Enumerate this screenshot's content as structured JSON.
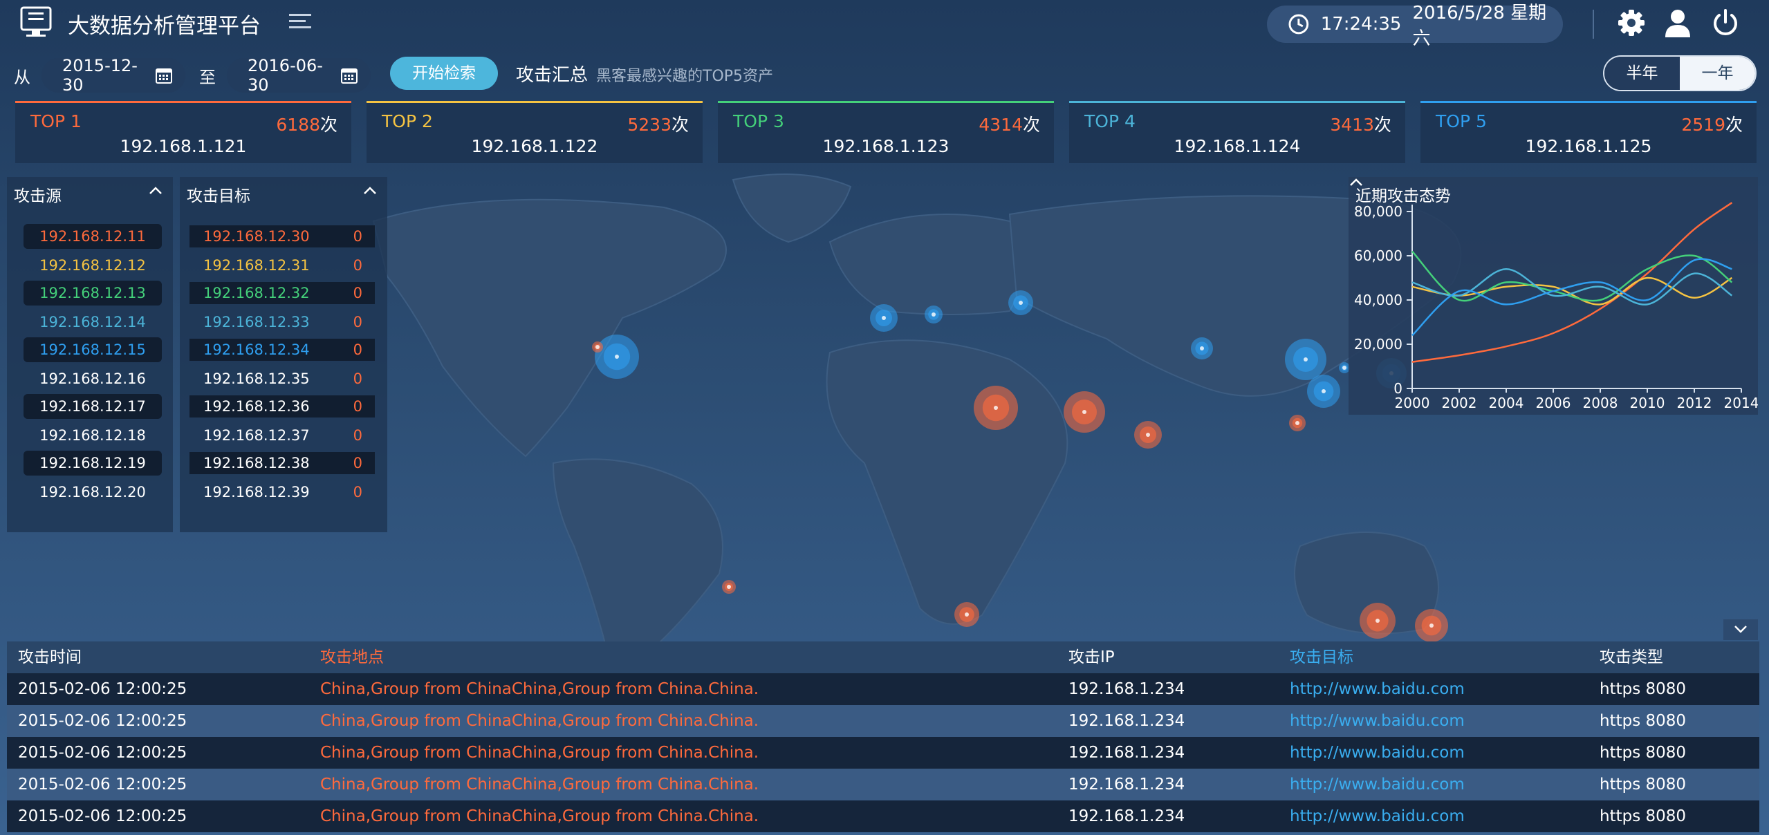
{
  "header": {
    "title": "大数据分析管理平台",
    "time": "17:24:35",
    "date": "2016/5/28 星期六",
    "icons": [
      "monitor-icon",
      "menu-icon",
      "clock-icon",
      "gear-icon",
      "user-icon",
      "power-icon"
    ]
  },
  "filter": {
    "from_label": "从",
    "from_value": "2015-12-30",
    "to_label": "至",
    "to_value": "2016-06-30",
    "search_label": "开始检索",
    "summary_title": "攻击汇总",
    "summary_sub": "黑客最感兴趣的TOP5资产",
    "range_options": [
      "半年",
      "一年"
    ],
    "range_selected": "半年"
  },
  "top_cards": [
    {
      "rank": "TOP 1",
      "count": "6188",
      "unit": "次",
      "ip": "192.168.1.121",
      "color": "#ff6a3c"
    },
    {
      "rank": "TOP 2",
      "count": "5233",
      "unit": "次",
      "ip": "192.168.1.122",
      "color": "#f5c342"
    },
    {
      "rank": "TOP 3",
      "count": "4314",
      "unit": "次",
      "ip": "192.168.1.123",
      "color": "#44d07a"
    },
    {
      "rank": "TOP 4",
      "count": "3413",
      "unit": "次",
      "ip": "192.168.1.124",
      "color": "#4cb4d8"
    },
    {
      "rank": "TOP 5",
      "count": "2519",
      "unit": "次",
      "ip": "192.168.1.125",
      "color": "#2f9ff0"
    }
  ],
  "sources": {
    "title": "攻击源",
    "items": [
      {
        "ip": "192.168.12.11",
        "color": "#ff6a3c"
      },
      {
        "ip": "192.168.12.12",
        "color": "#f5c342"
      },
      {
        "ip": "192.168.12.13",
        "color": "#44d07a"
      },
      {
        "ip": "192.168.12.14",
        "color": "#4cb4d8"
      },
      {
        "ip": "192.168.12.15",
        "color": "#2f9ff0"
      },
      {
        "ip": "192.168.12.16",
        "color": "#ffffff"
      },
      {
        "ip": "192.168.12.17",
        "color": "#ffffff"
      },
      {
        "ip": "192.168.12.18",
        "color": "#ffffff"
      },
      {
        "ip": "192.168.12.19",
        "color": "#ffffff"
      },
      {
        "ip": "192.168.12.20",
        "color": "#ffffff"
      }
    ]
  },
  "targets": {
    "title": "攻击目标",
    "items": [
      {
        "ip": "192.168.12.30",
        "value": "0",
        "color": "#ff6a3c"
      },
      {
        "ip": "192.168.12.31",
        "value": "0",
        "color": "#f5c342"
      },
      {
        "ip": "192.168.12.32",
        "value": "0",
        "color": "#44d07a"
      },
      {
        "ip": "192.168.12.33",
        "value": "0",
        "color": "#4cb4d8"
      },
      {
        "ip": "192.168.12.34",
        "value": "0",
        "color": "#2f9ff0"
      },
      {
        "ip": "192.168.12.35",
        "value": "0",
        "color": "#ffffff"
      },
      {
        "ip": "192.168.12.36",
        "value": "0",
        "color": "#ffffff"
      },
      {
        "ip": "192.168.12.37",
        "value": "0",
        "color": "#ffffff"
      },
      {
        "ip": "192.168.12.38",
        "value": "0",
        "color": "#ffffff"
      },
      {
        "ip": "192.168.12.39",
        "value": "0",
        "color": "#ffffff"
      }
    ]
  },
  "trend": {
    "title": "近期攻击态势",
    "chart_data": {
      "type": "line",
      "xlim": [
        2000,
        2014
      ],
      "ylim": [
        0,
        80000
      ],
      "xticks": [
        "2000",
        "2002",
        "2004",
        "2006",
        "2008",
        "2010",
        "2012",
        "2014"
      ],
      "yticks": [
        "0",
        "20,000",
        "40,000",
        "60,000",
        "80,000"
      ],
      "grid": false,
      "series": [
        {
          "color": "#ff6a3c",
          "x": [
            2000,
            2002,
            2004,
            2006,
            2008,
            2010,
            2012,
            2013.6
          ],
          "y": [
            12000,
            15000,
            19000,
            25000,
            36000,
            52000,
            72000,
            84000
          ]
        },
        {
          "color": "#f5c342",
          "x": [
            2000,
            2002,
            2004,
            2006,
            2008,
            2010,
            2012,
            2013.6
          ],
          "y": [
            46000,
            42000,
            46000,
            46000,
            38000,
            50000,
            41000,
            50000
          ]
        },
        {
          "color": "#44d07a",
          "x": [
            2000,
            2002,
            2004,
            2006,
            2008,
            2010,
            2012,
            2013.6
          ],
          "y": [
            62000,
            40000,
            48000,
            44000,
            40000,
            54000,
            60000,
            48000
          ]
        },
        {
          "color": "#4cb4d8",
          "x": [
            2000,
            2002,
            2004,
            2006,
            2008,
            2010,
            2012,
            2013.6
          ],
          "y": [
            48000,
            42000,
            54000,
            42000,
            46000,
            38000,
            52000,
            42000
          ]
        },
        {
          "color": "#2f9ff0",
          "x": [
            2000,
            2002,
            2004,
            2006,
            2008,
            2010,
            2012,
            2013.6
          ],
          "y": [
            24000,
            44000,
            38000,
            44000,
            48000,
            40000,
            58000,
            54000
          ]
        }
      ]
    }
  },
  "map": {
    "red_color": "#ff6a3c",
    "blue_color": "#2f9ff0"
  },
  "table": {
    "headers": [
      "攻击时间",
      "攻击地点",
      "攻击IP",
      "攻击目标",
      "攻击类型"
    ],
    "header_colors": [
      "#ffffff",
      "#ff6a3c",
      "#ffffff",
      "#3aaef0",
      "#ffffff"
    ],
    "rows": [
      {
        "time": "2015-02-06 12:00:25",
        "place": "China,Group from ChinaChina,Group from China.China.",
        "ip": "192.168.1.234",
        "target": "http://www.baidu.com",
        "type": "https 8080"
      },
      {
        "time": "2015-02-06 12:00:25",
        "place": "China,Group from ChinaChina,Group from China.China.",
        "ip": "192.168.1.234",
        "target": "http://www.baidu.com",
        "type": "https 8080"
      },
      {
        "time": "2015-02-06 12:00:25",
        "place": "China,Group from ChinaChina,Group from China.China.",
        "ip": "192.168.1.234",
        "target": "http://www.baidu.com",
        "type": "https 8080"
      },
      {
        "time": "2015-02-06 12:00:25",
        "place": "China,Group from ChinaChina,Group from China.China.",
        "ip": "192.168.1.234",
        "target": "http://www.baidu.com",
        "type": "https 8080"
      },
      {
        "time": "2015-02-06 12:00:25",
        "place": "China,Group from ChinaChina,Group from China.China.",
        "ip": "192.168.1.234",
        "target": "http://www.baidu.com",
        "type": "https 8080"
      }
    ]
  }
}
